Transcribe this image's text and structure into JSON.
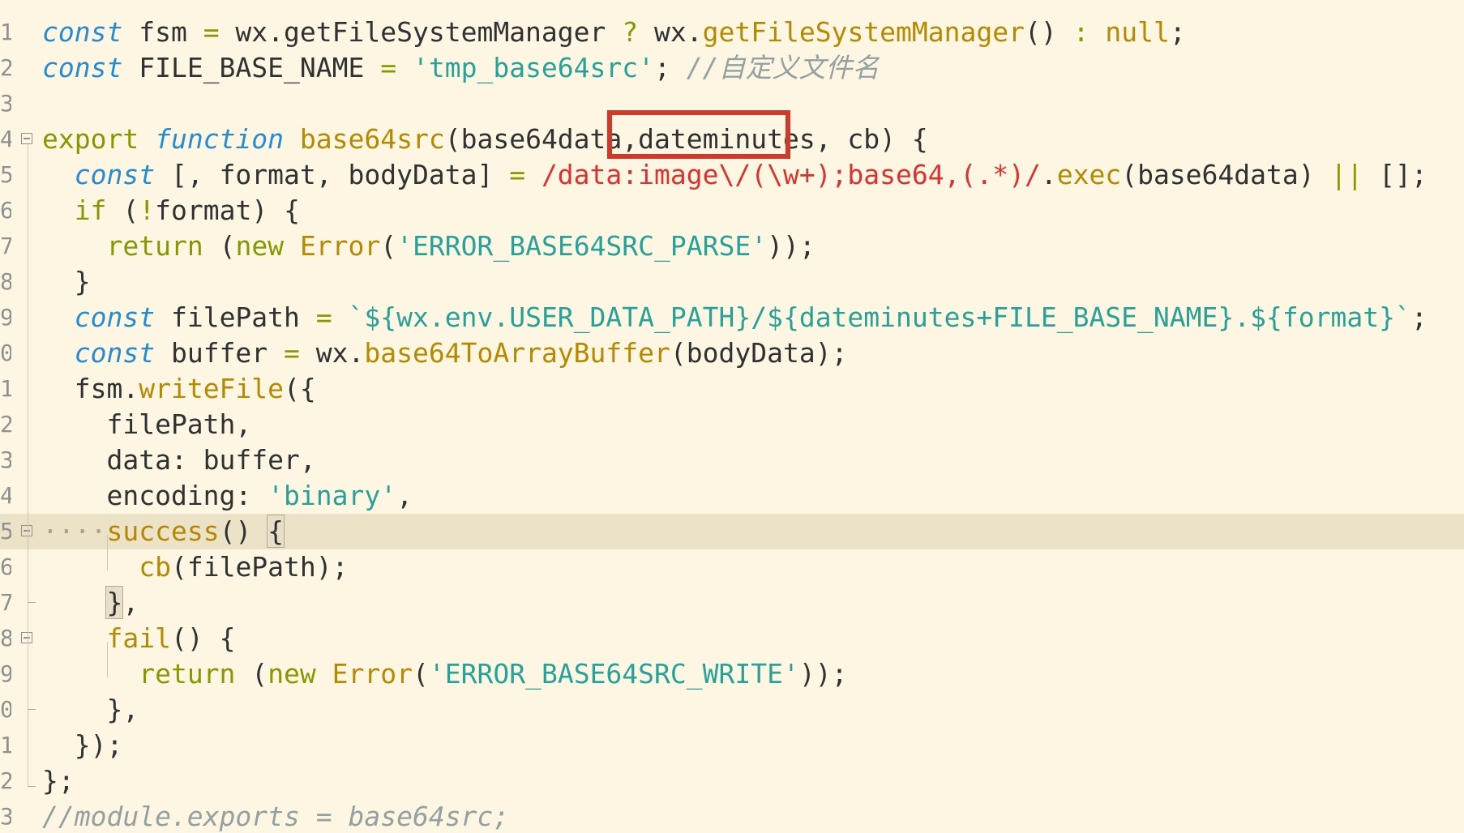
{
  "editor": {
    "line_numbers": [
      "1",
      "2",
      "3",
      "4",
      "5",
      "6",
      "7",
      "8",
      "9",
      "0",
      "1",
      "2",
      "3",
      "4",
      "5",
      "6",
      "7",
      "8",
      "9",
      "0",
      "1",
      "2",
      "3"
    ],
    "highlighted_line_index": 14,
    "folded_line_indices": [
      3,
      14,
      17
    ],
    "lines": [
      [
        {
          "t": "const",
          "c": "ki"
        },
        {
          "t": " fsm "
        },
        {
          "t": "=",
          "c": "k"
        },
        {
          "t": " wx."
        },
        {
          "t": "getFileSystemManager"
        },
        {
          "t": " "
        },
        {
          "t": "?",
          "c": "k"
        },
        {
          "t": " wx."
        },
        {
          "t": "getFileSystemManager",
          "c": "f"
        },
        {
          "t": "() "
        },
        {
          "t": ":",
          "c": "k"
        },
        {
          "t": " "
        },
        {
          "t": "null",
          "c": "f"
        },
        {
          "t": ";"
        }
      ],
      [
        {
          "t": "const",
          "c": "ki"
        },
        {
          "t": " FILE_BASE_NAME "
        },
        {
          "t": "=",
          "c": "k"
        },
        {
          "t": " "
        },
        {
          "t": "'tmp_base64src'",
          "c": "s"
        },
        {
          "t": "; "
        },
        {
          "t": "//自定义文件名",
          "c": "c"
        }
      ],
      [],
      [
        {
          "t": "export",
          "c": "k"
        },
        {
          "t": " "
        },
        {
          "t": "function",
          "c": "ki"
        },
        {
          "t": " "
        },
        {
          "t": "base64src",
          "c": "f"
        },
        {
          "t": "(base64data,dateminutes, cb) {"
        }
      ],
      [
        {
          "t": "  "
        },
        {
          "t": "const",
          "c": "ki"
        },
        {
          "t": " [, format, bodyData] "
        },
        {
          "t": "=",
          "c": "k"
        },
        {
          "t": " "
        },
        {
          "t": "/data:image\\/(\\w+);base64,(.*)/",
          "c": "r"
        },
        {
          "t": "."
        },
        {
          "t": "exec",
          "c": "f"
        },
        {
          "t": "(base64data) "
        },
        {
          "t": "||",
          "c": "k"
        },
        {
          "t": " [];"
        }
      ],
      [
        {
          "t": "  "
        },
        {
          "t": "if",
          "c": "k"
        },
        {
          "t": " ("
        },
        {
          "t": "!",
          "c": "k"
        },
        {
          "t": "format) {"
        }
      ],
      [
        {
          "t": "    "
        },
        {
          "t": "return",
          "c": "k"
        },
        {
          "t": " ("
        },
        {
          "t": "new",
          "c": "k"
        },
        {
          "t": " "
        },
        {
          "t": "Error",
          "c": "f"
        },
        {
          "t": "("
        },
        {
          "t": "'ERROR_BASE64SRC_PARSE'",
          "c": "s"
        },
        {
          "t": "));"
        }
      ],
      [
        {
          "t": "  }"
        }
      ],
      [
        {
          "t": "  "
        },
        {
          "t": "const",
          "c": "ki"
        },
        {
          "t": " filePath "
        },
        {
          "t": "=",
          "c": "k"
        },
        {
          "t": " "
        },
        {
          "t": "`${wx.env.USER_DATA_PATH}/${dateminutes+FILE_BASE_NAME}.${format}`",
          "c": "s"
        },
        {
          "t": ";"
        }
      ],
      [
        {
          "t": "  "
        },
        {
          "t": "const",
          "c": "ki"
        },
        {
          "t": " buffer "
        },
        {
          "t": "=",
          "c": "k"
        },
        {
          "t": " wx."
        },
        {
          "t": "base64ToArrayBuffer",
          "c": "f"
        },
        {
          "t": "(bodyData);"
        }
      ],
      [
        {
          "t": "  fsm."
        },
        {
          "t": "writeFile",
          "c": "f"
        },
        {
          "t": "({"
        }
      ],
      [
        {
          "t": "    filePath,"
        }
      ],
      [
        {
          "t": "    data: buffer,"
        }
      ],
      [
        {
          "t": "    encoding: "
        },
        {
          "t": "'binary'",
          "c": "s"
        },
        {
          "t": ","
        }
      ],
      [
        {
          "t": "····",
          "c": "dots"
        },
        {
          "t": "success",
          "c": "f"
        },
        {
          "t": "() "
        },
        {
          "t": "{",
          "c": "bm"
        }
      ],
      [
        {
          "t": "      "
        },
        {
          "t": "cb",
          "c": "f"
        },
        {
          "t": "(filePath);"
        }
      ],
      [
        {
          "t": "    "
        },
        {
          "t": "}",
          "c": "bm"
        },
        {
          "t": ","
        }
      ],
      [
        {
          "t": "    "
        },
        {
          "t": "fail",
          "c": "f"
        },
        {
          "t": "() {"
        }
      ],
      [
        {
          "t": "      "
        },
        {
          "t": "return",
          "c": "k"
        },
        {
          "t": " ("
        },
        {
          "t": "new",
          "c": "k"
        },
        {
          "t": " "
        },
        {
          "t": "Error",
          "c": "f"
        },
        {
          "t": "("
        },
        {
          "t": "'ERROR_BASE64SRC_WRITE'",
          "c": "s"
        },
        {
          "t": "));"
        }
      ],
      [
        {
          "t": "    },"
        }
      ],
      [
        {
          "t": "  });"
        }
      ],
      [
        {
          "t": "};"
        }
      ],
      [
        {
          "t": "//module.exports = base64src;",
          "c": "c"
        }
      ]
    ]
  },
  "annotation": {
    "target_text": "dateminutes",
    "color": "#cf3a2a"
  },
  "theme": {
    "background": "#fdf6e3",
    "highlight_line": "#ece2c8",
    "keyword": "#859900",
    "storage": "#268bd2",
    "function": "#b58900",
    "string": "#2aa198",
    "regex": "#dc322f",
    "comment": "#93a1a1"
  }
}
